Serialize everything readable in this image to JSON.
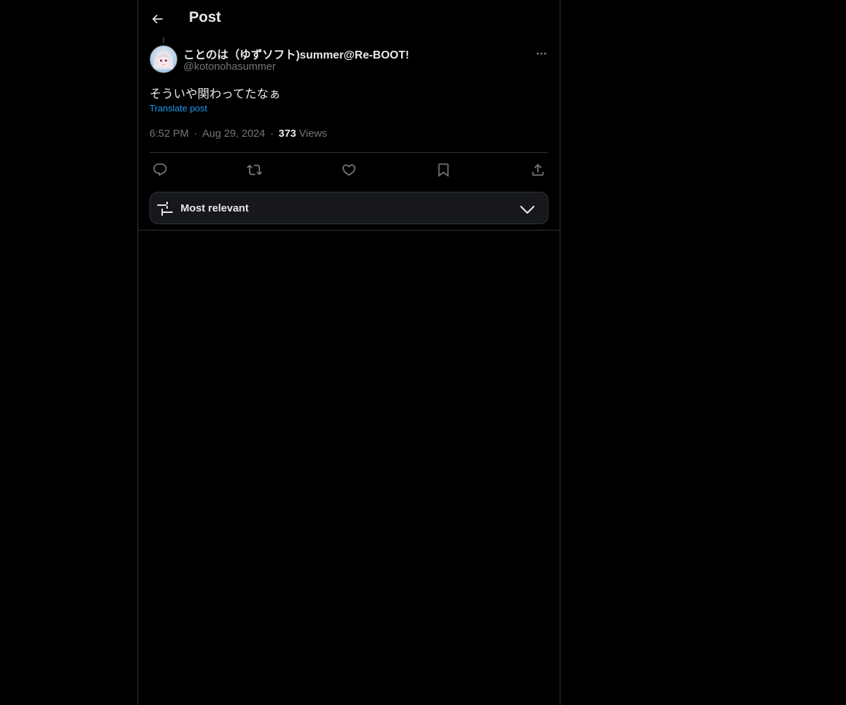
{
  "header": {
    "title": "Post"
  },
  "post": {
    "author": {
      "name": "ことのは（ゆずソフト)summer@Re-BOOT!",
      "handle": "@kotonohasummer"
    },
    "text": "そういや関わってたなぁ",
    "translate_label": "Translate post",
    "time": "6:52 PM",
    "date": "Aug 29, 2024",
    "views_count": "373",
    "views_label": "Views",
    "separator": "·"
  },
  "actions": {
    "icons": [
      "reply-icon",
      "repost-icon",
      "like-icon",
      "bookmark-icon",
      "share-icon"
    ]
  },
  "sort": {
    "label": "Most relevant"
  },
  "colors": {
    "background": "#000000",
    "text": "#e7e9ea",
    "muted": "#71767b",
    "accent": "#1d9bf0",
    "border": "#2f3336"
  }
}
